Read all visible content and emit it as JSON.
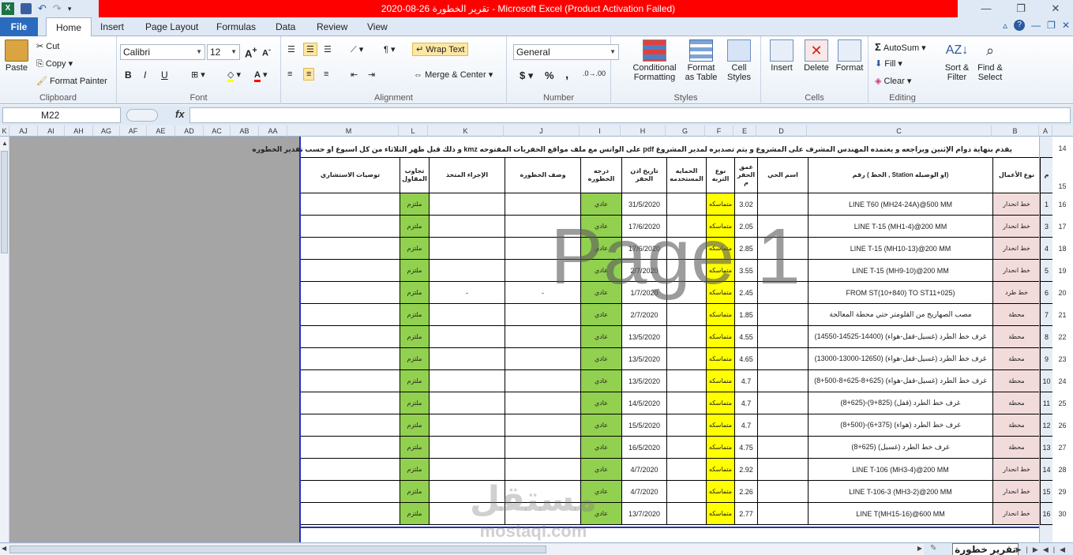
{
  "window": {
    "title": "تقرير الخطورة 26-08-2020  -  Microsoft Excel (Product Activation Failed)",
    "accent": "#ff0000"
  },
  "tabs": [
    {
      "label": "File"
    },
    {
      "label": "Home"
    },
    {
      "label": "Insert"
    },
    {
      "label": "Page Layout"
    },
    {
      "label": "Formulas"
    },
    {
      "label": "Data"
    },
    {
      "label": "Review"
    },
    {
      "label": "View"
    }
  ],
  "ribbon": {
    "clipboard": {
      "paste": "Paste",
      "cut": "Cut",
      "copy": "Copy",
      "format_painter": "Format Painter",
      "label": "Clipboard"
    },
    "font": {
      "name": "Calibri",
      "size": "12",
      "bold": "B",
      "italic": "I",
      "underline": "U",
      "label": "Font"
    },
    "alignment": {
      "wrap": "Wrap Text",
      "merge": "Merge & Center",
      "label": "Alignment"
    },
    "number": {
      "format": "General",
      "currency": "$",
      "percent": "%",
      "comma": ",",
      "label": "Number"
    },
    "styles": {
      "conditional": "Conditional Formatting",
      "format_table": "Format as Table",
      "cell_styles": "Cell Styles",
      "label": "Styles"
    },
    "cells": {
      "insert": "Insert",
      "delete": "Delete",
      "format": "Format",
      "label": "Cells"
    },
    "editing": {
      "autosum": "AutoSum",
      "fill": "Fill",
      "clear": "Clear",
      "sort": "Sort & Filter",
      "find": "Find & Select",
      "label": "Editing"
    }
  },
  "formula_bar": {
    "name_box": "M22",
    "fx": "fx",
    "value": ""
  },
  "column_headers": [
    "K",
    "AJ",
    "AI",
    "AH",
    "AG",
    "AF",
    "AE",
    "AD",
    "AC",
    "AB",
    "AA",
    "M",
    "L",
    "K",
    "J",
    "I",
    "H",
    "G",
    "F",
    "E",
    "D",
    "C",
    "B",
    "A"
  ],
  "sheet": {
    "note": "يقدم بنهاية دوام الإثنين ويراجعه و يعتمده المهندس المشرف على المشروع و يتم تصديره لمدير المشروع pdf على الواتس مع ملف مواقع الحفريات المفتوحه kmz و ذلك قبل ظهر الثلاثاء من كل اسبوع او حسب تقدير الخطوره",
    "watermark": "Page 1",
    "logo": "مستقل",
    "logo_sub": "mostaql.com",
    "headers": {
      "m": "م",
      "work_type": "نوع الأعمال",
      "line_no": "رقم ( الخط , Station او الوصيله)",
      "district": "اسم الحي",
      "depth": "عمق الحفر م",
      "soil": "نوع التربه",
      "protection": "الحمايه المستخدمه",
      "date": "تاريخ اذن الحفر",
      "risk": "درجه الخطوره",
      "risk_desc": "وصف الخطوره",
      "action": "الإجراء المتخذ",
      "contractor": "تجاوب المقاول",
      "consultant": "توصيات الاستشاري"
    },
    "rows": [
      {
        "m": "1",
        "work_type": "خط انحدار",
        "line": "LINE T60 (MH24-24A)@500 MM",
        "depth": "3.02",
        "soil": "متماسكه",
        "date": "31/5/2020",
        "risk": "عادي",
        "risk_desc": "",
        "action": "",
        "contractor": "ملتزم"
      },
      {
        "m": "3",
        "work_type": "خط انحدار",
        "line": "LINE T-15 (MH1-4)@200 MM",
        "depth": "2.05",
        "soil": "متماسكه",
        "date": "17/6/2020",
        "risk": "عادي",
        "risk_desc": "",
        "action": "",
        "contractor": "ملتزم"
      },
      {
        "m": "4",
        "work_type": "خط انحدار",
        "line": "LINE T-15 (MH10-13)@200 MM",
        "depth": "2.85",
        "soil": "متماسكه",
        "date": "17/6/2020",
        "risk": "عادي",
        "risk_desc": "",
        "action": "",
        "contractor": "ملتزم"
      },
      {
        "m": "5",
        "work_type": "خط انحدار",
        "line": "LINE T-15 (MH9-10)@200 MM",
        "depth": "3.55",
        "soil": "متماسكه",
        "date": "2/7/2020",
        "risk": "عادي",
        "risk_desc": "",
        "action": "",
        "contractor": "ملتزم"
      },
      {
        "m": "6",
        "work_type": "خط طرد",
        "line": "FROM ST(10+840) TO ST11+025)",
        "depth": "2.45",
        "soil": "متماسكه",
        "date": "1/7/2020",
        "risk": "عادي",
        "risk_desc": "-",
        "action": "-",
        "contractor": "ملتزم"
      },
      {
        "m": "7",
        "work_type": "محطة",
        "line": "مصب الصهاريج من القلومتر حتي محطة المعالجة",
        "depth": "1.85",
        "soil": "متماسكه",
        "date": "2/7/2020",
        "risk": "عادي",
        "risk_desc": "",
        "action": "",
        "contractor": "ملتزم"
      },
      {
        "m": "8",
        "work_type": "محطة",
        "line": "غرف خط الطرد (غسيل-قفل-هواء) (14400-14525-14550)",
        "depth": "4.55",
        "soil": "متماسكه",
        "date": "13/5/2020",
        "risk": "عادي",
        "risk_desc": "",
        "action": "",
        "contractor": "ملتزم"
      },
      {
        "m": "9",
        "work_type": "محطة",
        "line": "غرف خط الطرد (غسيل-قفل-هواء) (12650-13000-13000)",
        "depth": "4.65",
        "soil": "متماسكه",
        "date": "13/5/2020",
        "risk": "عادي",
        "risk_desc": "",
        "action": "",
        "contractor": "ملتزم"
      },
      {
        "m": "10",
        "work_type": "محطة",
        "line": "غرف خط الطرد (غسيل-قفل-هواء) (625+8-625+8-500+8)",
        "depth": "4.7",
        "soil": "متماسكه",
        "date": "13/5/2020",
        "risk": "عادي",
        "risk_desc": "",
        "action": "",
        "contractor": "ملتزم"
      },
      {
        "m": "11",
        "work_type": "محطة",
        "line": "غرف خط الطرد (قفل) (825+9)-(625+8)",
        "depth": "4.7",
        "soil": "متماسكه",
        "date": "14/5/2020",
        "risk": "عادي",
        "risk_desc": "",
        "action": "",
        "contractor": "ملتزم"
      },
      {
        "m": "12",
        "work_type": "محطة",
        "line": "غرف خط الطرد (هواء) (375+6)-(500+8)",
        "depth": "4.7",
        "soil": "متماسكه",
        "date": "15/5/2020",
        "risk": "عادي",
        "risk_desc": "",
        "action": "",
        "contractor": "ملتزم"
      },
      {
        "m": "13",
        "work_type": "محطة",
        "line": "غرف خط الطرد (غسيل) (625+8)",
        "depth": "4.75",
        "soil": "متماسكه",
        "date": "16/5/2020",
        "risk": "عادي",
        "risk_desc": "",
        "action": "",
        "contractor": "ملتزم"
      },
      {
        "m": "14",
        "work_type": "خط انحدار",
        "line": "LINE T-106 (MH3-4)@200 MM",
        "depth": "2.92",
        "soil": "متماسكه",
        "date": "4/7/2020",
        "risk": "عادي",
        "risk_desc": "",
        "action": "",
        "contractor": "ملتزم"
      },
      {
        "m": "15",
        "work_type": "خط انحدار",
        "line": "LINE T-106-3 (MH3-2)@200 MM",
        "depth": "2.26",
        "soil": "متماسكه",
        "date": "4/7/2020",
        "risk": "عادي",
        "risk_desc": "",
        "action": "",
        "contractor": "ملتزم"
      },
      {
        "m": "16",
        "work_type": "خط انحدار",
        "line": "LINE T(MH15-16)@600 MM",
        "depth": "2.77",
        "soil": "متماسكه",
        "date": "13/7/2020",
        "risk": "عادي",
        "risk_desc": "",
        "action": "",
        "contractor": "ملتزم"
      }
    ],
    "row_numbers": [
      "14",
      "15",
      "16",
      "17",
      "18",
      "19",
      "20",
      "21",
      "22",
      "23",
      "24",
      "25",
      "26",
      "27",
      "28",
      "29",
      "30"
    ]
  },
  "sheet_tab": {
    "label": "تقرير خطورة"
  },
  "colors": {
    "soil": "#ffff00",
    "green": "#92d050",
    "pink": "#f2dcdb",
    "border_blue": "#2232b8"
  }
}
